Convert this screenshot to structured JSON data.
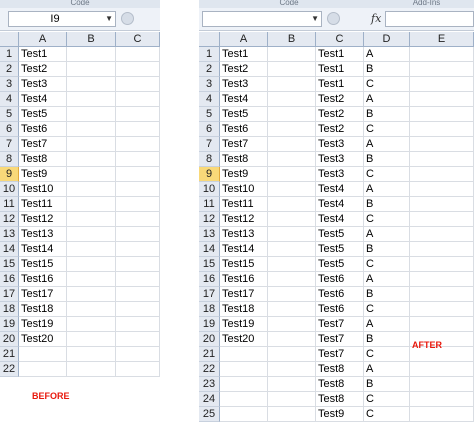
{
  "before": {
    "ribbon_label": "Code",
    "name_box": "I9",
    "columns": [
      "A",
      "B",
      "C"
    ],
    "row_numbers": [
      "1",
      "2",
      "3",
      "4",
      "5",
      "6",
      "7",
      "8",
      "9",
      "10",
      "11",
      "12",
      "13",
      "14",
      "15",
      "16",
      "17",
      "18",
      "19",
      "20",
      "21",
      "22"
    ],
    "selected_row": "9",
    "col_a": [
      "Test1",
      "Test2",
      "Test3",
      "Test4",
      "Test5",
      "Test6",
      "Test7",
      "Test8",
      "Test9",
      "Test10",
      "Test11",
      "Test12",
      "Test13",
      "Test14",
      "Test15",
      "Test16",
      "Test17",
      "Test18",
      "Test19",
      "Test20",
      "",
      ""
    ],
    "caption": "BEFORE"
  },
  "after": {
    "ribbon_labels": [
      "Code",
      "Add-Ins"
    ],
    "fx_symbol": "fx",
    "columns": [
      "A",
      "B",
      "C",
      "D",
      "E"
    ],
    "row_numbers": [
      "1",
      "2",
      "3",
      "4",
      "5",
      "6",
      "7",
      "8",
      "9",
      "10",
      "11",
      "12",
      "13",
      "14",
      "15",
      "16",
      "17",
      "18",
      "19",
      "20",
      "21",
      "22",
      "23",
      "24",
      "25"
    ],
    "selected_row": "9",
    "col_a": [
      "Test1",
      "Test2",
      "Test3",
      "Test4",
      "Test5",
      "Test6",
      "Test7",
      "Test8",
      "Test9",
      "Test10",
      "Test11",
      "Test12",
      "Test13",
      "Test14",
      "Test15",
      "Test16",
      "Test17",
      "Test18",
      "Test19",
      "Test20",
      "",
      "",
      "",
      "",
      ""
    ],
    "col_c": [
      "Test1",
      "Test1",
      "Test1",
      "Test2",
      "Test2",
      "Test2",
      "Test3",
      "Test3",
      "Test3",
      "Test4",
      "Test4",
      "Test4",
      "Test5",
      "Test5",
      "Test5",
      "Test6",
      "Test6",
      "Test6",
      "Test7",
      "Test7",
      "Test7",
      "Test8",
      "Test8",
      "Test8",
      "Test9"
    ],
    "col_d": [
      "A",
      "B",
      "C",
      "A",
      "B",
      "C",
      "A",
      "B",
      "C",
      "A",
      "B",
      "C",
      "A",
      "B",
      "C",
      "A",
      "B",
      "C",
      "A",
      "B",
      "C",
      "A",
      "B",
      "C",
      "C"
    ],
    "caption": "AFTER"
  }
}
